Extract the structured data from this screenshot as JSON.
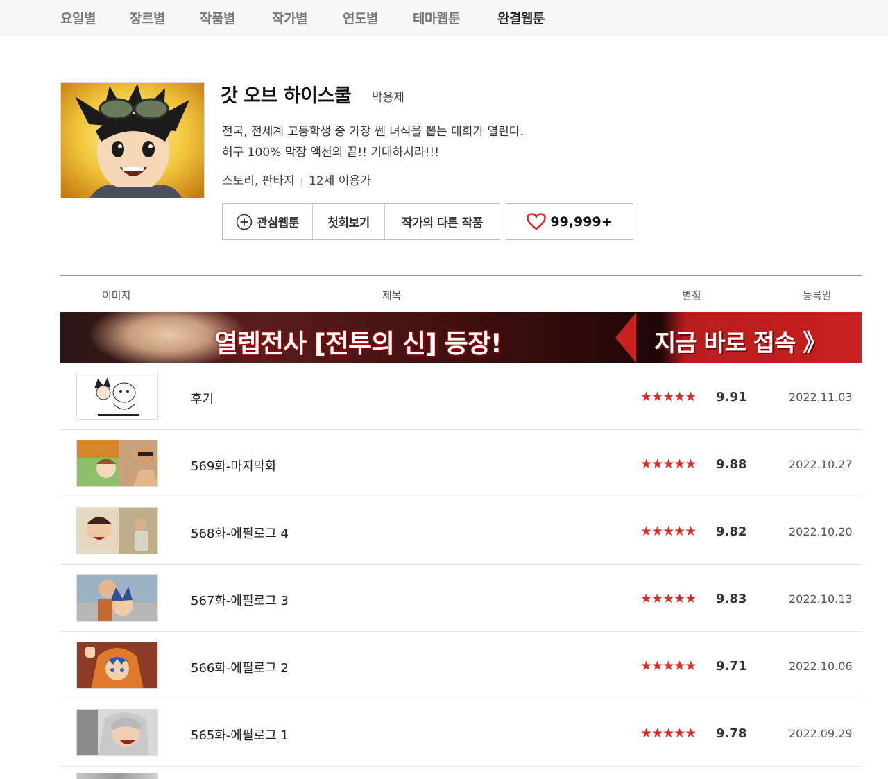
{
  "nav": {
    "items": [
      {
        "label": "요일별"
      },
      {
        "label": "장르별"
      },
      {
        "label": "작품별"
      },
      {
        "label": "작가별"
      },
      {
        "label": "연도별"
      },
      {
        "label": "테마웹툰"
      },
      {
        "label": "완결웹툰",
        "active": true
      }
    ]
  },
  "webtoon": {
    "title": "갓 오브 하이스쿨",
    "author": "박용제",
    "description_line1": "전국, 전세계 고등학생 중 가장 쎈 녀석을 뽑는 대회가 열린다.",
    "description_line2": "허구 100% 막장 액션의 끝!! 기대하시라!!!",
    "genre": "스토리, 판타지",
    "age_rating": "12세 이용가"
  },
  "actions": {
    "favorite_label": "관심웹툰",
    "first_episode_label": "첫회보기",
    "other_works_label": "작가의 다른 작품",
    "like_count": "99,999+",
    "icons": {
      "favorite": "plus-circle-icon",
      "like": "heart-icon"
    }
  },
  "table": {
    "headers": {
      "image": "이미지",
      "title": "제목",
      "rating": "별점",
      "date": "등록일"
    }
  },
  "banner": {
    "text_left": "열렙전사 [전투의 신] 등장!",
    "text_right": "지금 바로 접속 》"
  },
  "episodes": [
    {
      "title": "후기",
      "stars": "★★★★★",
      "rating": "9.91",
      "date": "2022.11.03"
    },
    {
      "title": "569화-마지막화",
      "stars": "★★★★★",
      "rating": "9.88",
      "date": "2022.10.27"
    },
    {
      "title": "568화-에필로그 4",
      "stars": "★★★★★",
      "rating": "9.82",
      "date": "2022.10.20"
    },
    {
      "title": "567화-에필로그 3",
      "stars": "★★★★★",
      "rating": "9.83",
      "date": "2022.10.13"
    },
    {
      "title": "566화-에필로그 2",
      "stars": "★★★★★",
      "rating": "9.71",
      "date": "2022.10.06"
    },
    {
      "title": "565화-에필로그 1",
      "stars": "★★★★★",
      "rating": "9.78",
      "date": "2022.09.29"
    }
  ],
  "colors": {
    "star": "#e02a2a",
    "active_nav": "#222222",
    "inactive_nav": "#777777"
  }
}
